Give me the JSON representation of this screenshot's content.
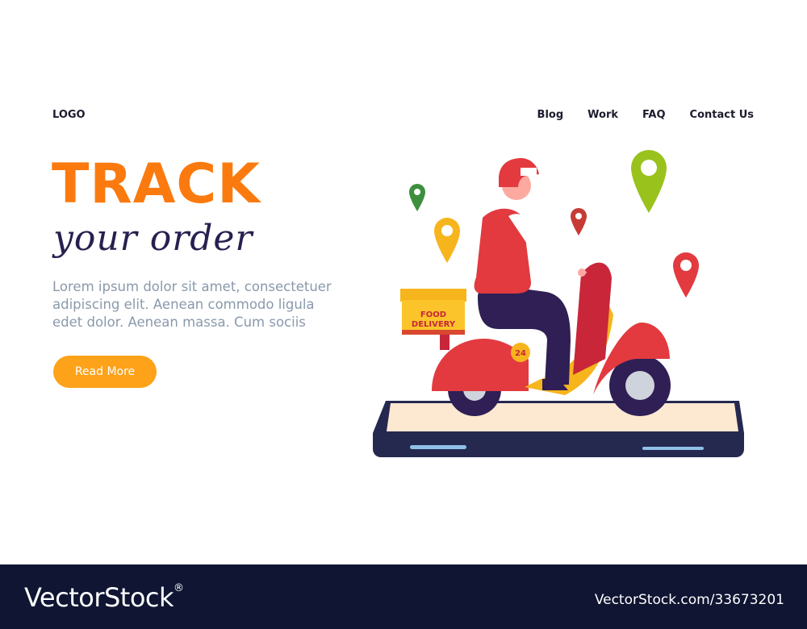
{
  "header": {
    "logo": "LOGO",
    "nav": [
      "Blog",
      "Work",
      "FAQ",
      "Contact Us"
    ]
  },
  "hero": {
    "headline": "TRACK",
    "subheadline": "your order",
    "body": "Lorem ipsum dolor sit amet, consectetuer adipiscing elit. Aenean commodo ligula edet dolor. Aenean massa. Cum sociis",
    "cta": "Read More"
  },
  "illustration": {
    "box_label_1": "FOOD",
    "box_label_2": "DELIVERY",
    "scooter_number": "24",
    "pin_colors": [
      "#3d8f3e",
      "#f7b51d",
      "#99c21d",
      "#c73b36",
      "#e23a3f"
    ]
  },
  "colors": {
    "accent": "#fb7a0f",
    "button": "#fda219",
    "text_dark": "#27204f",
    "text_muted": "#8a99ab",
    "footer_bg": "#0f1532"
  },
  "watermark": {
    "brand": "VectorStock",
    "reg": "®",
    "id": "VectorStock.com/33673201"
  }
}
